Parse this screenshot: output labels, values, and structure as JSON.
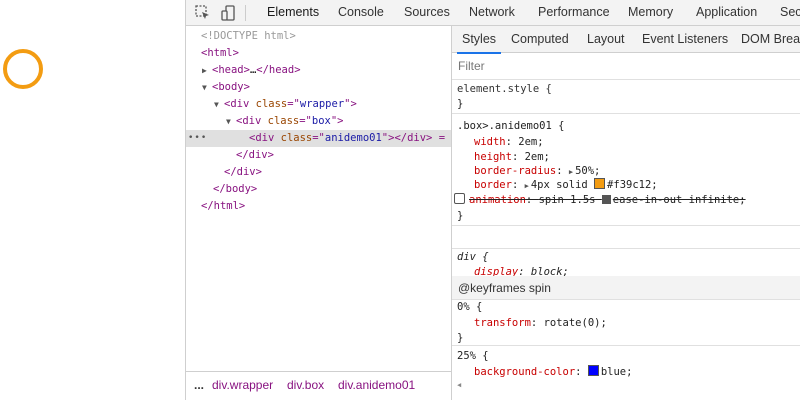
{
  "page": {
    "circle_color": "#f39c12"
  },
  "toolbar": {
    "icons": [
      "inspect-icon",
      "device-toggle-icon"
    ],
    "tabs": [
      "Elements",
      "Console",
      "Sources",
      "Network",
      "Performance",
      "Memory",
      "Application",
      "Secu"
    ],
    "active_tab": "Elements",
    "accent": "#1a73e8"
  },
  "elements": {
    "doctype": "<!DOCTYPE html>",
    "html_open": "<html>",
    "head_collapsed": {
      "open": "<head>",
      "ellipsis": "…",
      "close": "</head>"
    },
    "body_open": "<body>",
    "wrapper": {
      "tag": "div",
      "attr": "class",
      "value": "wrapper"
    },
    "box": {
      "tag": "div",
      "attr": "class",
      "value": "box"
    },
    "anidemo": {
      "tag": "div",
      "attr": "class",
      "value": "anidemo01",
      "suffix": "</div> ="
    },
    "div_close": "</div>",
    "body_close": "</body>",
    "html_close": "</html>",
    "dots": "•••"
  },
  "breadcrumb": {
    "more": "...",
    "items": [
      "div.wrapper",
      "div.box",
      "div.anidemo01"
    ]
  },
  "styles": {
    "tabs": [
      "Styles",
      "Computed",
      "Layout",
      "Event Listeners",
      "DOM Breakpoints"
    ],
    "active_tab": "Styles",
    "filter_placeholder": "Filter",
    "element_style": {
      "selector": "element.style {",
      "close": "}"
    },
    "rule1": {
      "selector": ".box>.anidemo01 {",
      "props": [
        {
          "name": "width",
          "value": "2em;"
        },
        {
          "name": "height",
          "value": "2em;"
        },
        {
          "name": "border-radius",
          "value": "50%;"
        },
        {
          "name": "border",
          "value": "4px solid",
          "color_value": "#f39c12;"
        },
        {
          "name": "animation",
          "value": "spin 1.5s",
          "tail": "ease-in-out infinite;"
        }
      ],
      "swatch_color": "#f39c12",
      "close": "}"
    },
    "rule2": {
      "selector": "div {",
      "props": [
        {
          "name": "display",
          "value": "block;"
        }
      ],
      "close": "}"
    },
    "keyframes": {
      "header": "@keyframes spin",
      "frames": [
        {
          "selector": "0% {",
          "props": [
            {
              "name": "transform",
              "value": "rotate(0);"
            }
          ],
          "close": "}"
        },
        {
          "selector": "25% {",
          "props": [
            {
              "name": "background-color",
              "value": "blue;"
            }
          ]
        }
      ],
      "blue_swatch": "#0000ff"
    }
  }
}
